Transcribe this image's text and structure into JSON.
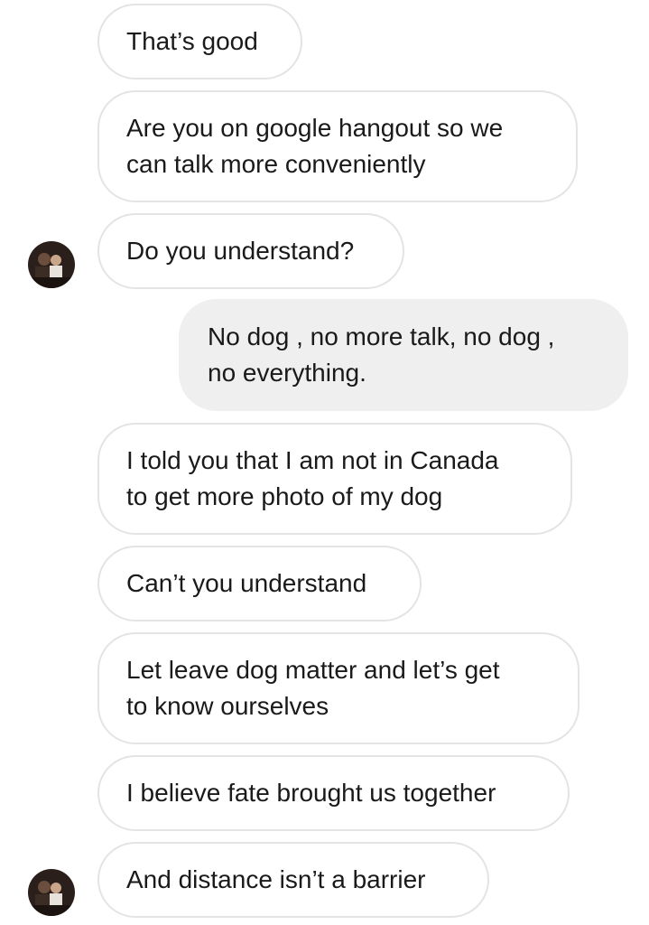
{
  "conversation": {
    "messages": [
      {
        "sender": "other",
        "text": [
          "That’s good"
        ]
      },
      {
        "sender": "other",
        "text": [
          "Are you on google hangout so we",
          "can talk more conveniently"
        ]
      },
      {
        "sender": "other",
        "text": [
          "Do you understand?"
        ],
        "avatar": true
      },
      {
        "sender": "me",
        "text": [
          "No dog , no more talk, no dog ,",
          "no everything."
        ]
      },
      {
        "sender": "other",
        "text": [
          "I told you that I am not in Canada",
          "to get more photo of my dog"
        ]
      },
      {
        "sender": "other",
        "text": [
          "Can’t you understand"
        ]
      },
      {
        "sender": "other",
        "text": [
          "Let leave dog matter and let’s get",
          "to know ourselves"
        ]
      },
      {
        "sender": "other",
        "text": [
          "I believe fate brought us together"
        ]
      },
      {
        "sender": "other",
        "text": [
          "And distance isn’t a barrier"
        ],
        "avatar": true
      }
    ]
  },
  "colors": {
    "incoming_bubble_border": "#e4e4e4",
    "outgoing_bubble_bg": "#efefef",
    "text": "#1a1a1a"
  },
  "icons": {
    "avatar": "contact-avatar-icon"
  }
}
